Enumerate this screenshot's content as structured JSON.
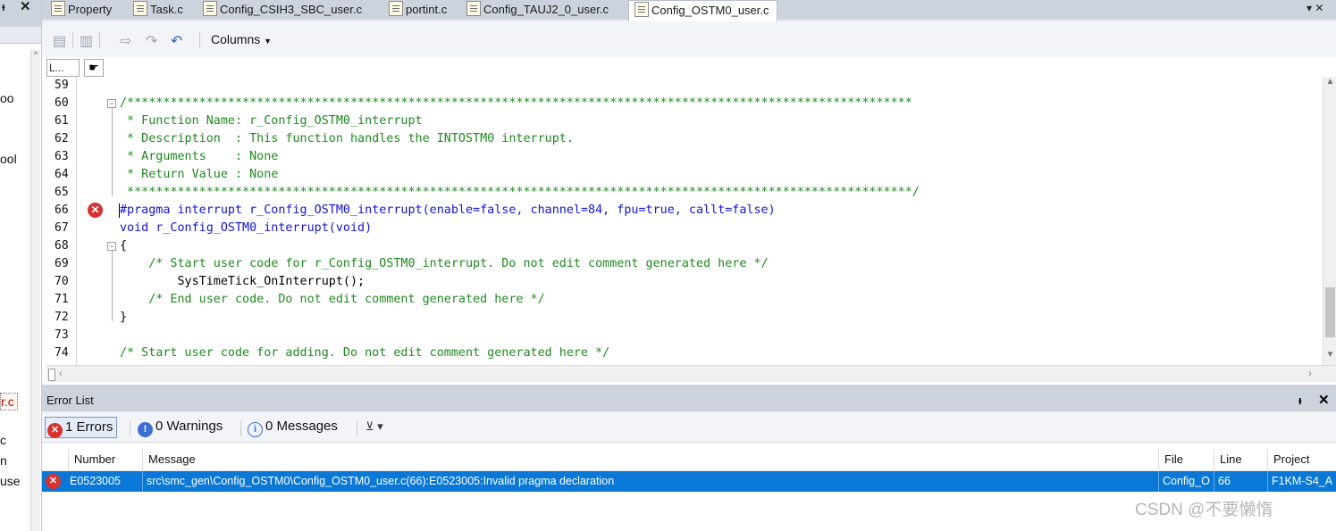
{
  "left_panel": {
    "pin": "ᵼ",
    "close": "✕",
    "scroll_up": "^",
    "fragments": [
      "oo",
      "ool",
      "r.c",
      "c",
      "n",
      "use"
    ]
  },
  "tabs": [
    {
      "label": "Property"
    },
    {
      "label": "Task.c"
    },
    {
      "label": "Config_CSIH3_SBC_user.c"
    },
    {
      "label": "portint.c"
    },
    {
      "label": "Config_TAUJ2_0_user.c"
    },
    {
      "label": "Config_OSTM0_user.c",
      "active": true
    }
  ],
  "tab_dropdown": "▾ ✕",
  "toolbar": {
    "columns_label": "Columns"
  },
  "editor": {
    "line_header": "L...",
    "hand_icon": "☛",
    "lines": [
      {
        "n": "59",
        "text": ""
      },
      {
        "n": "60",
        "text": "/*************************************************************************************************************"
      },
      {
        "n": "61",
        "text": " * Function Name: r_Config_OSTM0_interrupt"
      },
      {
        "n": "62",
        "text": " * Description  : This function handles the INTOSTM0 interrupt."
      },
      {
        "n": "63",
        "text": " * Arguments    : None"
      },
      {
        "n": "64",
        "text": " * Return Value : None"
      },
      {
        "n": "65",
        "text": " *************************************************************************************************************/"
      },
      {
        "n": "66",
        "text": "#pragma interrupt r_Config_OSTM0_interrupt(enable=false, channel=84, fpu=true, callt=false)"
      },
      {
        "n": "67",
        "text": "void r_Config_OSTM0_interrupt(void)"
      },
      {
        "n": "68",
        "text": "{"
      },
      {
        "n": "69",
        "text": "    /* Start user code for r_Config_OSTM0_interrupt. Do not edit comment generated here */"
      },
      {
        "n": "70",
        "text": "        SysTimeTick_OnInterrupt();"
      },
      {
        "n": "71",
        "text": "    /* End user code. Do not edit comment generated here */"
      },
      {
        "n": "72",
        "text": "}"
      },
      {
        "n": "73",
        "text": ""
      },
      {
        "n": "74",
        "text": "/* Start user code for adding. Do not edit comment generated here */"
      }
    ]
  },
  "error_list": {
    "title": "Error List",
    "pin": "ᵼ",
    "close": "✕",
    "filters": {
      "errors": "1 Errors",
      "warnings": "0 Warnings",
      "messages": "0 Messages",
      "filter_icon": "⊻ ▾"
    },
    "columns": [
      "Number",
      "Message",
      "File",
      "Line",
      "Project"
    ],
    "rows": [
      {
        "number": "E0523005",
        "message": "src\\smc_gen\\Config_OSTM0\\Config_OSTM0_user.c(66):E0523005:Invalid pragma declaration",
        "file": "Config_O",
        "line": "66",
        "project": "F1KM-S4_A"
      }
    ]
  },
  "watermark": "CSDN @不要懒惰",
  "colors": {
    "comment": "#1f8a1f",
    "keyword": "#1414d8",
    "selection": "#0a78d7",
    "error": "#d93030"
  }
}
